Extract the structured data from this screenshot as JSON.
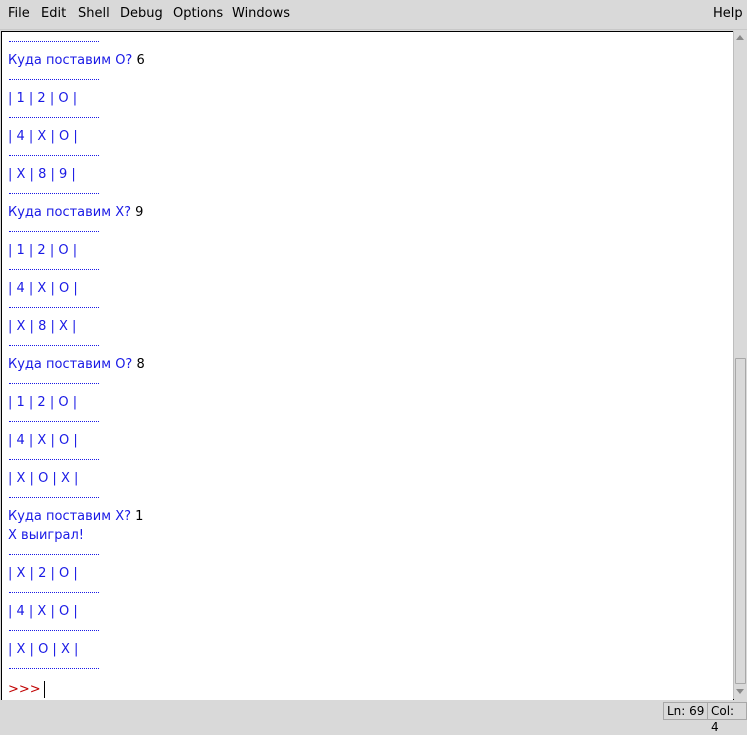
{
  "menubar": {
    "file": "File",
    "edit": "Edit",
    "shell": "Shell",
    "debug": "Debug",
    "options": "Options",
    "windows": "Windows",
    "help": "Help"
  },
  "shell": {
    "board1": {
      "row1": "| 1 | 2 | O |",
      "row2": "| 4 | X | O |",
      "row3": "| X | 8 | 9 |"
    },
    "board2": {
      "row1": "| 1 | 2 | O |",
      "row2": "| 4 | X | O |",
      "row3": "| X | 8 | X |"
    },
    "board3": {
      "row1": "| 1 | 2 | O |",
      "row2": "| 4 | X | O |",
      "row3": "| X | O | X |"
    },
    "board4": {
      "row1": "| X | 2 | O |",
      "row2": "| 4 | X | O |",
      "row3": "| X | O | X |"
    },
    "q1": {
      "prompt": "Куда поставим O? ",
      "answer": "6"
    },
    "q2": {
      "prompt": "Куда поставим X? ",
      "answer": "9"
    },
    "q3": {
      "prompt": "Куда поставим O? ",
      "answer": "8"
    },
    "q4": {
      "prompt": "Куда поставим X? ",
      "answer": "1"
    },
    "result": "X выиграл!",
    "prompt": ">>>"
  },
  "status": {
    "line": "Ln: 69",
    "col": "Col: 4"
  }
}
